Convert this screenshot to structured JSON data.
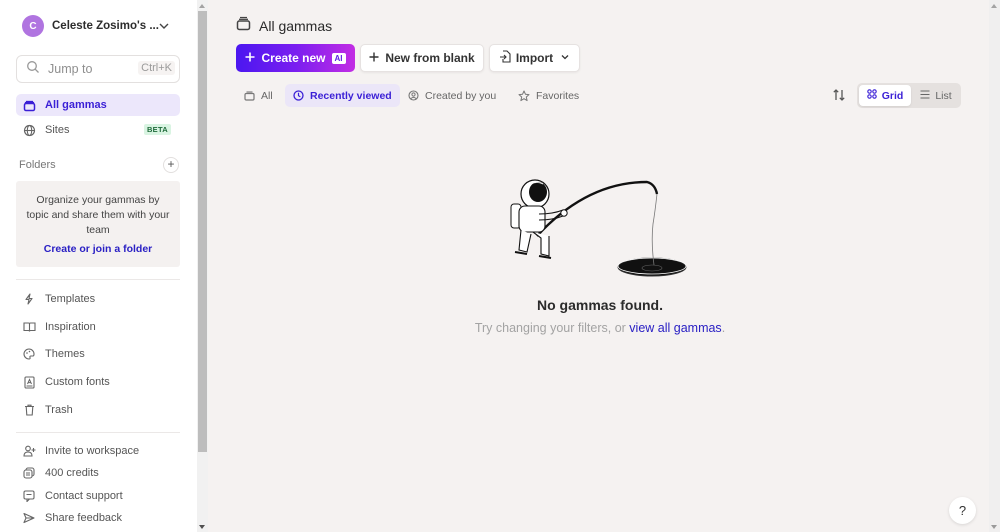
{
  "sidebar": {
    "workspace": {
      "avatar_initial": "C",
      "name": "Celeste Zosimo's ..."
    },
    "jump": {
      "placeholder": "Jump to",
      "shortcut": "Ctrl+K"
    },
    "primary": [
      {
        "label": "All gammas",
        "icon": "stack-icon",
        "active": true
      },
      {
        "label": "Sites",
        "icon": "globe-icon",
        "badge": "BETA"
      }
    ],
    "folders": {
      "label": "Folders",
      "empty_text": "Organize your gammas by topic and share them with your team",
      "link": "Create or join a folder"
    },
    "secondary": [
      {
        "label": "Templates",
        "icon": "lightning-icon"
      },
      {
        "label": "Inspiration",
        "icon": "book-icon"
      },
      {
        "label": "Themes",
        "icon": "palette-icon"
      },
      {
        "label": "Custom fonts",
        "icon": "font-icon"
      },
      {
        "label": "Trash",
        "icon": "trash-icon"
      }
    ],
    "footer": [
      {
        "label": "Invite to workspace",
        "icon": "add-user-icon"
      },
      {
        "label": "400 credits",
        "icon": "coins-icon"
      },
      {
        "label": "Contact support",
        "icon": "chat-icon"
      },
      {
        "label": "Share feedback",
        "icon": "send-icon"
      }
    ]
  },
  "main": {
    "title": "All gammas",
    "buttons": {
      "create_new": "Create new",
      "ai_badge": "AI",
      "new_from_blank": "New from blank",
      "import": "Import"
    },
    "filters": [
      {
        "label": "All",
        "active": false
      },
      {
        "label": "Recently viewed",
        "active": true
      },
      {
        "label": "Created by you",
        "active": false
      },
      {
        "label": "Favorites",
        "active": false
      }
    ],
    "view": {
      "grid": "Grid",
      "list": "List",
      "selected": "Grid"
    },
    "empty": {
      "title": "No gammas found.",
      "subtitle": "Try changing your filters, or ",
      "link": "view all gammas",
      "period": "."
    },
    "help": "?"
  },
  "colors": {
    "accent": "#3a1fd6",
    "active_bg": "#ece7fb",
    "gradient_start": "#4b17f0",
    "gradient_end": "#c22de4",
    "beta_bg": "#d9f4e2",
    "background": "#f5f2f1"
  }
}
